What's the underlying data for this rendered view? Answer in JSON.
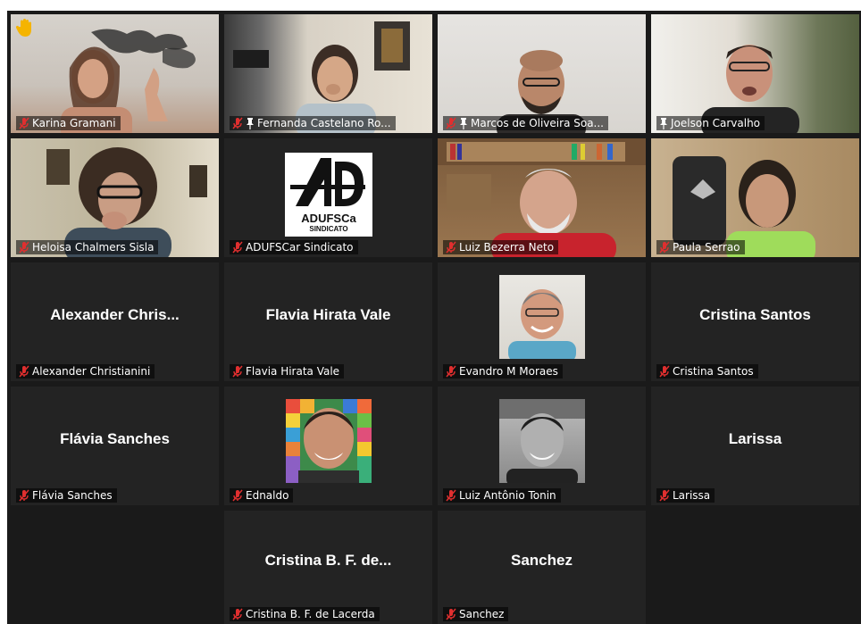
{
  "meeting": {
    "participants": [
      {
        "display": "Karina Gramani",
        "big": "",
        "type": "video",
        "muted": true,
        "pinned": false,
        "hand": true
      },
      {
        "display": "Fernanda Castelano Ro...",
        "big": "",
        "type": "video",
        "muted": true,
        "pinned": true
      },
      {
        "display": "Marcos de Oliveira Soa...",
        "big": "",
        "type": "video",
        "muted": true,
        "pinned": true
      },
      {
        "display": "Joelson Carvalho",
        "big": "",
        "type": "video",
        "muted": false,
        "pinned": true,
        "active": true
      },
      {
        "display": "Heloisa Chalmers Sisla",
        "big": "",
        "type": "video",
        "muted": true
      },
      {
        "display": "ADUFSCar Sindicato",
        "big": "",
        "type": "logo",
        "muted": true
      },
      {
        "display": "Luiz Bezerra Neto",
        "big": "",
        "type": "video",
        "muted": true
      },
      {
        "display": "Paula Serrao",
        "big": "",
        "type": "video",
        "muted": true
      },
      {
        "display": "Alexander Christianini",
        "big": "Alexander  Chris...",
        "type": "name",
        "muted": true
      },
      {
        "display": "Flavia Hirata Vale",
        "big": "Flavia Hirata Vale",
        "type": "name",
        "muted": true
      },
      {
        "display": "Evandro M Moraes",
        "big": "",
        "type": "photo",
        "muted": true
      },
      {
        "display": "Cristina Santos",
        "big": "Cristina Santos",
        "type": "name",
        "muted": true
      },
      {
        "display": "Flávia Sanches",
        "big": "Flávia Sanches",
        "type": "name",
        "muted": true
      },
      {
        "display": "Ednaldo",
        "big": "",
        "type": "photo",
        "muted": true
      },
      {
        "display": "Luiz Antônio Tonin",
        "big": "",
        "type": "photo",
        "muted": true
      },
      {
        "display": "Larissa",
        "big": "Larissa",
        "type": "name",
        "muted": true
      },
      {
        "display": "Cristina B. F. de Lacerda",
        "big": "Cristina B. F. de...",
        "type": "name",
        "muted": true
      },
      {
        "display": "Sanchez",
        "big": "Sanchez",
        "type": "name",
        "muted": true
      }
    ],
    "logo": {
      "text_main": "ADUFSCa",
      "text_sub": "SINDICATO"
    }
  },
  "colors": {
    "muted_icon": "#e02f2f",
    "active_border": "#d8e9a5",
    "tile_bg": "#232323",
    "hand": "#f5b400"
  }
}
